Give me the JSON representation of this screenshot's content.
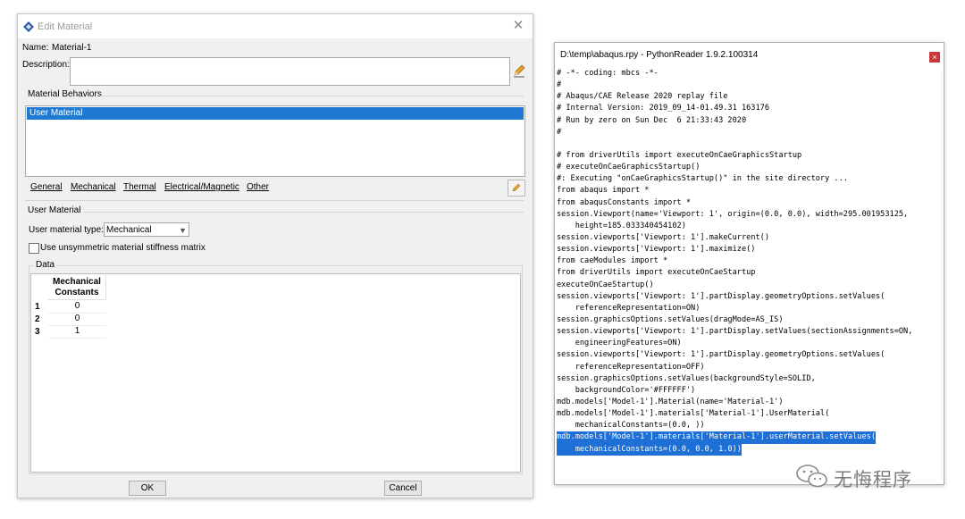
{
  "edit_material": {
    "title": "Edit Material",
    "name_label": "Name:",
    "name_value": "Material-1",
    "description_label": "Description:",
    "description_value": "",
    "behaviors_title": "Material Behaviors",
    "behaviors": [
      "User Material"
    ],
    "menu": [
      "General",
      "Mechanical",
      "Thermal",
      "Electrical/Magnetic",
      "Other"
    ],
    "user_material_title": "User Material",
    "material_type_label": "User material type:",
    "material_type_value": "Mechanical",
    "unsym_label": "Use unsymmetric material stiffness matrix",
    "unsym_checked": false,
    "data_title": "Data",
    "table": {
      "header_line1": "Mechanical",
      "header_line2": "Constants",
      "rows": [
        {
          "index": "1",
          "value": "0"
        },
        {
          "index": "2",
          "value": "0"
        },
        {
          "index": "3",
          "value": "1"
        }
      ]
    },
    "ok_label": "OK",
    "cancel_label": "Cancel",
    "icons": {
      "title": "abaqus-logo-icon",
      "edit": "pencil-icon",
      "close": "close-icon"
    }
  },
  "python_reader": {
    "title": "D:\\temp\\abaqus.rpy - PythonReader 1.9.2.100314",
    "close_label": "×",
    "lines": [
      "# -*- coding: mbcs -*-",
      "#",
      "# Abaqus/CAE Release 2020 replay file",
      "# Internal Version: 2019_09_14-01.49.31 163176",
      "# Run by zero on Sun Dec  6 21:33:43 2020",
      "#",
      "",
      "# from driverUtils import executeOnCaeGraphicsStartup",
      "# executeOnCaeGraphicsStartup()",
      "#: Executing \"onCaeGraphicsStartup()\" in the site directory ...",
      "from abaqus import *",
      "from abaqusConstants import *",
      "session.Viewport(name='Viewport: 1', origin=(0.0, 0.0), width=295.001953125,",
      "    height=185.033340454102)",
      "session.viewports['Viewport: 1'].makeCurrent()",
      "session.viewports['Viewport: 1'].maximize()",
      "from caeModules import *",
      "from driverUtils import executeOnCaeStartup",
      "executeOnCaeStartup()",
      "session.viewports['Viewport: 1'].partDisplay.geometryOptions.setValues(",
      "    referenceRepresentation=ON)",
      "session.graphicsOptions.setValues(dragMode=AS_IS)",
      "session.viewports['Viewport: 1'].partDisplay.setValues(sectionAssignments=ON,",
      "    engineeringFeatures=ON)",
      "session.viewports['Viewport: 1'].partDisplay.geometryOptions.setValues(",
      "    referenceRepresentation=OFF)",
      "session.graphicsOptions.setValues(backgroundStyle=SOLID,",
      "    backgroundColor='#FFFFFF')",
      "mdb.models['Model-1'].Material(name='Material-1')",
      "mdb.models['Model-1'].materials['Material-1'].UserMaterial(",
      "    mechanicalConstants=(0.0, ))"
    ],
    "highlighted_lines": [
      "mdb.models['Model-1'].materials['Material-1'].userMaterial.setValues(",
      "    mechanicalConstants=(0.0, 0.0, 1.0))"
    ]
  },
  "watermark": {
    "text": "无悔程序",
    "icon": "wechat-icon"
  },
  "colors": {
    "selection": "#1e7ad2",
    "code_highlight": "#1e6fd6",
    "close_red": "#c8373a"
  }
}
